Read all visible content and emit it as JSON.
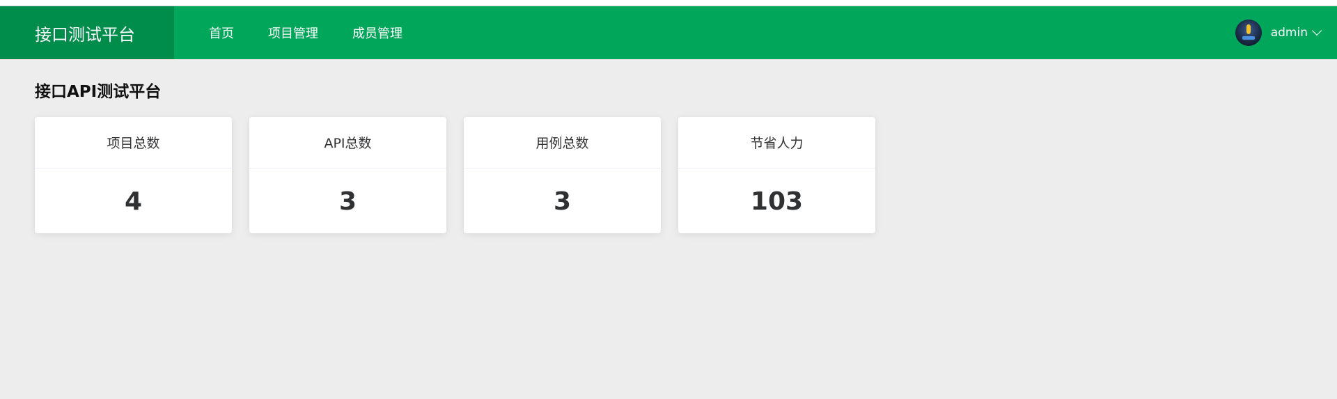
{
  "header": {
    "brand": "接口测试平台",
    "nav": [
      {
        "label": "首页"
      },
      {
        "label": "项目管理"
      },
      {
        "label": "成员管理"
      }
    ],
    "user": {
      "name": "admin",
      "avatar_icon": "user-avatar",
      "dropdown_icon": "chevron-down-icon"
    },
    "colors": {
      "header_bg": "#00a65a",
      "brand_bg": "#008d4c"
    }
  },
  "main": {
    "title": "接口API测试平台",
    "stats": [
      {
        "label": "项目总数",
        "value": "4"
      },
      {
        "label": "API总数",
        "value": "3"
      },
      {
        "label": "用例总数",
        "value": "3"
      },
      {
        "label": "节省人力",
        "value": "103"
      }
    ]
  }
}
